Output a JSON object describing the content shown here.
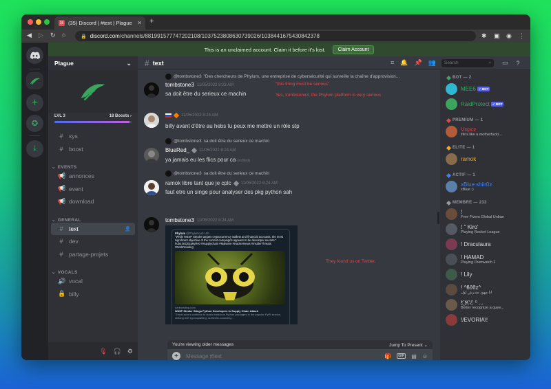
{
  "browser": {
    "tab_title": "(35) Discord | #text | Plague",
    "tab_badge": "35",
    "url_host": "discord.com",
    "url_path": "/channels/881991577747202108/1037523808630739026/1038441675430842378"
  },
  "notice": {
    "text": "This is an unclaimed account. Claim it before it's lost.",
    "button": "Claim Account"
  },
  "server": {
    "name": "Plague",
    "level": "LVL 3",
    "boosts": "18 Boosts",
    "boost_progress": 0.97
  },
  "channels": {
    "top": [
      {
        "name": "sys",
        "glyph": "#"
      },
      {
        "name": "boost",
        "glyph": "#"
      }
    ],
    "categories": [
      {
        "label": "EVENTS",
        "items": [
          {
            "name": "annonces",
            "glyph": "📢"
          },
          {
            "name": "event",
            "glyph": "📢"
          },
          {
            "name": "download",
            "glyph": "📢"
          }
        ]
      },
      {
        "label": "GENERAL",
        "items": [
          {
            "name": "text",
            "glyph": "#"
          },
          {
            "name": "dev",
            "glyph": "#"
          },
          {
            "name": "partage-projets",
            "glyph": "#"
          }
        ]
      },
      {
        "label": "VOCALS",
        "items": [
          {
            "name": "vocal",
            "glyph": "🔊"
          },
          {
            "name": "billy",
            "glyph": "🔒"
          }
        ]
      }
    ]
  },
  "chat": {
    "channel_name": "text",
    "search_placeholder": "Search",
    "messages": [
      {
        "reply_author": "@tombstone3",
        "reply_text": "\"Des chercheurs de Phylum, une entreprise de cybersécurité qui surveille la chaîne d'approvision...",
        "author": "tombstone3",
        "timestamp": "11/05/2022 8:23 AM",
        "text": "sa doit être du serieux ce machin",
        "side_note_1": "\"this thing must be serious\"",
        "side_note_2": "Yes, tombstone3, the Phylum platform is very serious"
      },
      {
        "author": "",
        "timestamp": "11/05/2022 8:24 AM",
        "text": "billy avant d'être au hebs tu peux me mettre un rôle stp"
      },
      {
        "reply_author": "@tombstone3",
        "reply_text": "sa doit être du serieux ce machin",
        "author": "BlueRed_",
        "timestamp": "11/05/2022 8:24 AM",
        "text": "ya jamais eu les flics pour ca",
        "edited": "(edited)"
      },
      {
        "reply_author": "@tombstone3",
        "reply_text": "sa doit être du serieux ce machin",
        "author": "",
        "timestamp": "11/05/2022 8:24 AM",
        "text_author_inline": "ramok libre tant que je cplc",
        "text": "faut etre un singe pour analyser des pkg python sah"
      },
      {
        "author": "tombstone3",
        "timestamp": "11/05/2022 8:24 AM",
        "side_note": "They found us on Twitter.",
        "embed": {
          "account": "Phylum",
          "handle": "@PhylumLab",
          "time": "10h",
          "quote": "\"While W4SP Stealer targets cryptocurrency wallets and financial accounts, the most significant objective of the current campaigns appears to be developer secrets.\"",
          "link": "hubs.la/Q01p6yRv0 #Supplychain #Malware #HackerNews #InsiderThreats #DarkReading",
          "site": "darkreading.com",
          "headline": "W4SP Stealer Stings Python Developers in Supply Chain Attack",
          "desc": "Threat actors continue to stash malicious Python packages in the popular PyPI service, striking with typosquatting, authentic-sounding..."
        }
      }
    ],
    "older_banner": "You're viewing older messages",
    "jump_label": "Jump To Present",
    "composer_placeholder": "Message #text"
  },
  "members": {
    "groups": [
      {
        "label": "BOT — 2",
        "color": "#3ba55d",
        "members": [
          {
            "name": "MEE6",
            "bot": "✓ BOT",
            "color": "#2eb8cf",
            "name_color": "#3ba55d",
            "status": ""
          },
          {
            "name": "RaidProtect",
            "bot": "✓ BOT",
            "color": "#3ba55d",
            "name_color": "#3ba55d",
            "status": ""
          }
        ]
      },
      {
        "label": "PREMIUM — 1",
        "color": "#ed4245",
        "members": [
          {
            "name": "Vnpcz",
            "color": "#b35b3a",
            "name_color": "#ed4245",
            "status": "life's like a motherfucki..."
          }
        ]
      },
      {
        "label": "ELITE — 1",
        "color": "#faa61a",
        "members": [
          {
            "name": "ramok",
            "color": "#8a6b4a",
            "name_color": "#faa61a",
            "status": ""
          }
        ]
      },
      {
        "label": "ACTIF — 1",
        "color": "#3b82f6",
        "members": [
          {
            "name": "xBlue shiir0z",
            "color": "#5a7fa8",
            "name_color": "#3b82f6",
            "status": "xBlue :)"
          }
        ]
      },
      {
        "label": "MEMBRE — 233",
        "color": "#96989d",
        "members": [
          {
            "name": "!",
            "color": "#6b4c3b",
            "name_color": "#dcddde",
            "status": "Free Fivem Global Unban"
          },
          {
            "name": "! '' Kiro'",
            "color": "#555a62",
            "name_color": "#dcddde",
            "status": "Playing Rocket League"
          },
          {
            "name": "! Draculaura",
            "color": "#7a3a52",
            "name_color": "#dcddde",
            "status": ""
          },
          {
            "name": "! HAMAD",
            "color": "#4a4f57",
            "name_color": "#dcddde",
            "status": "Playing Overwatch 2"
          },
          {
            "name": "! Lily",
            "color": "#3e5b4a",
            "name_color": "#dcddde",
            "status": ""
          },
          {
            "name": "! ^ϐϑϑz^",
            "color": "#5b4a3e",
            "name_color": "#dcddde",
            "status": "انا مهود نقدرش لول"
          },
          {
            "name": "! ҈ K'ℰ ⁰ ...",
            "color": "#6a5a4a",
            "name_color": "#dcddde",
            "status": "Better recognize a quee..."
          },
          {
            "name": "!/EVORIA\\!",
            "color": "#8a3a3a",
            "name_color": "#dcddde",
            "status": ""
          }
        ]
      }
    ]
  },
  "colors": {
    "accent": "#5865f2",
    "green": "#3ba55d",
    "red": "#ed4245"
  }
}
